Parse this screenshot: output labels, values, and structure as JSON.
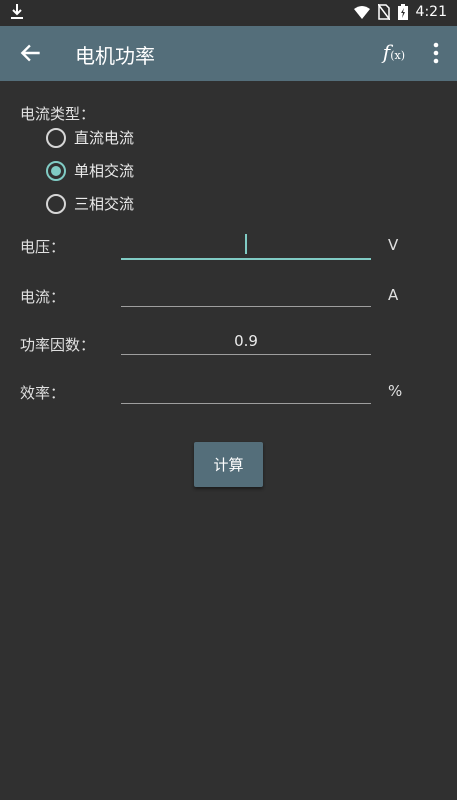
{
  "status_bar": {
    "time": "4:21"
  },
  "app_bar": {
    "title": "电机功率",
    "fx_label": "f",
    "fx_sub": "(x)"
  },
  "form": {
    "current_type_label": "电流类型：",
    "current_types": [
      {
        "label": "直流电流",
        "checked": false
      },
      {
        "label": "单相交流",
        "checked": true
      },
      {
        "label": "三相交流",
        "checked": false
      }
    ],
    "voltage": {
      "label": "电压：",
      "value": "",
      "unit": "V"
    },
    "current": {
      "label": "电流：",
      "value": "",
      "unit": "A"
    },
    "power_factor": {
      "label": "功率因数：",
      "value": "0.9"
    },
    "efficiency": {
      "label": "效率：",
      "value": "",
      "unit": "%"
    }
  },
  "calculate_button": "计算",
  "colors": {
    "app_bar": "#546e7a",
    "accent": "#80cbc4",
    "background": "#303030"
  }
}
